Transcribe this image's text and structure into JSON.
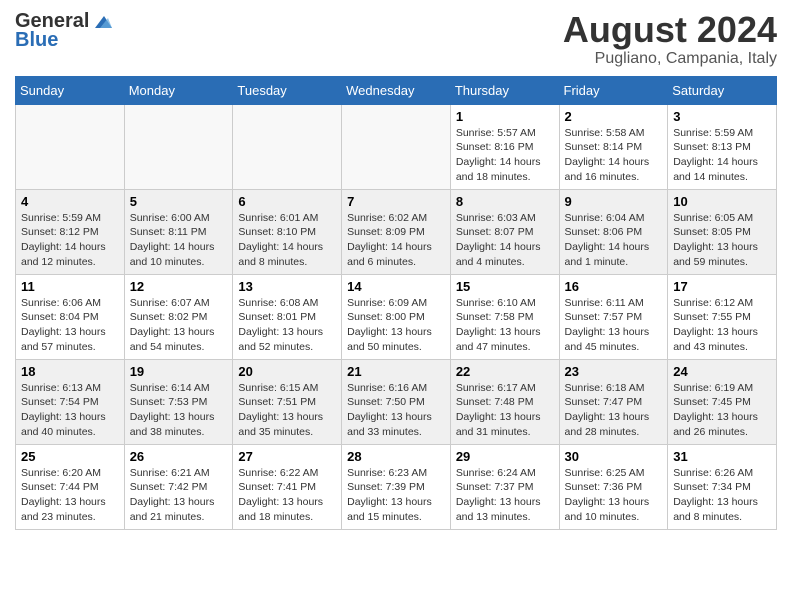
{
  "header": {
    "logo_general": "General",
    "logo_blue": "Blue",
    "title": "August 2024",
    "subtitle": "Pugliano, Campania, Italy"
  },
  "weekdays": [
    "Sunday",
    "Monday",
    "Tuesday",
    "Wednesday",
    "Thursday",
    "Friday",
    "Saturday"
  ],
  "weeks": [
    [
      {
        "day": "",
        "info": ""
      },
      {
        "day": "",
        "info": ""
      },
      {
        "day": "",
        "info": ""
      },
      {
        "day": "",
        "info": ""
      },
      {
        "day": "1",
        "info": "Sunrise: 5:57 AM\nSunset: 8:16 PM\nDaylight: 14 hours\nand 18 minutes."
      },
      {
        "day": "2",
        "info": "Sunrise: 5:58 AM\nSunset: 8:14 PM\nDaylight: 14 hours\nand 16 minutes."
      },
      {
        "day": "3",
        "info": "Sunrise: 5:59 AM\nSunset: 8:13 PM\nDaylight: 14 hours\nand 14 minutes."
      }
    ],
    [
      {
        "day": "4",
        "info": "Sunrise: 5:59 AM\nSunset: 8:12 PM\nDaylight: 14 hours\nand 12 minutes."
      },
      {
        "day": "5",
        "info": "Sunrise: 6:00 AM\nSunset: 8:11 PM\nDaylight: 14 hours\nand 10 minutes."
      },
      {
        "day": "6",
        "info": "Sunrise: 6:01 AM\nSunset: 8:10 PM\nDaylight: 14 hours\nand 8 minutes."
      },
      {
        "day": "7",
        "info": "Sunrise: 6:02 AM\nSunset: 8:09 PM\nDaylight: 14 hours\nand 6 minutes."
      },
      {
        "day": "8",
        "info": "Sunrise: 6:03 AM\nSunset: 8:07 PM\nDaylight: 14 hours\nand 4 minutes."
      },
      {
        "day": "9",
        "info": "Sunrise: 6:04 AM\nSunset: 8:06 PM\nDaylight: 14 hours\nand 1 minute."
      },
      {
        "day": "10",
        "info": "Sunrise: 6:05 AM\nSunset: 8:05 PM\nDaylight: 13 hours\nand 59 minutes."
      }
    ],
    [
      {
        "day": "11",
        "info": "Sunrise: 6:06 AM\nSunset: 8:04 PM\nDaylight: 13 hours\nand 57 minutes."
      },
      {
        "day": "12",
        "info": "Sunrise: 6:07 AM\nSunset: 8:02 PM\nDaylight: 13 hours\nand 54 minutes."
      },
      {
        "day": "13",
        "info": "Sunrise: 6:08 AM\nSunset: 8:01 PM\nDaylight: 13 hours\nand 52 minutes."
      },
      {
        "day": "14",
        "info": "Sunrise: 6:09 AM\nSunset: 8:00 PM\nDaylight: 13 hours\nand 50 minutes."
      },
      {
        "day": "15",
        "info": "Sunrise: 6:10 AM\nSunset: 7:58 PM\nDaylight: 13 hours\nand 47 minutes."
      },
      {
        "day": "16",
        "info": "Sunrise: 6:11 AM\nSunset: 7:57 PM\nDaylight: 13 hours\nand 45 minutes."
      },
      {
        "day": "17",
        "info": "Sunrise: 6:12 AM\nSunset: 7:55 PM\nDaylight: 13 hours\nand 43 minutes."
      }
    ],
    [
      {
        "day": "18",
        "info": "Sunrise: 6:13 AM\nSunset: 7:54 PM\nDaylight: 13 hours\nand 40 minutes."
      },
      {
        "day": "19",
        "info": "Sunrise: 6:14 AM\nSunset: 7:53 PM\nDaylight: 13 hours\nand 38 minutes."
      },
      {
        "day": "20",
        "info": "Sunrise: 6:15 AM\nSunset: 7:51 PM\nDaylight: 13 hours\nand 35 minutes."
      },
      {
        "day": "21",
        "info": "Sunrise: 6:16 AM\nSunset: 7:50 PM\nDaylight: 13 hours\nand 33 minutes."
      },
      {
        "day": "22",
        "info": "Sunrise: 6:17 AM\nSunset: 7:48 PM\nDaylight: 13 hours\nand 31 minutes."
      },
      {
        "day": "23",
        "info": "Sunrise: 6:18 AM\nSunset: 7:47 PM\nDaylight: 13 hours\nand 28 minutes."
      },
      {
        "day": "24",
        "info": "Sunrise: 6:19 AM\nSunset: 7:45 PM\nDaylight: 13 hours\nand 26 minutes."
      }
    ],
    [
      {
        "day": "25",
        "info": "Sunrise: 6:20 AM\nSunset: 7:44 PM\nDaylight: 13 hours\nand 23 minutes."
      },
      {
        "day": "26",
        "info": "Sunrise: 6:21 AM\nSunset: 7:42 PM\nDaylight: 13 hours\nand 21 minutes."
      },
      {
        "day": "27",
        "info": "Sunrise: 6:22 AM\nSunset: 7:41 PM\nDaylight: 13 hours\nand 18 minutes."
      },
      {
        "day": "28",
        "info": "Sunrise: 6:23 AM\nSunset: 7:39 PM\nDaylight: 13 hours\nand 15 minutes."
      },
      {
        "day": "29",
        "info": "Sunrise: 6:24 AM\nSunset: 7:37 PM\nDaylight: 13 hours\nand 13 minutes."
      },
      {
        "day": "30",
        "info": "Sunrise: 6:25 AM\nSunset: 7:36 PM\nDaylight: 13 hours\nand 10 minutes."
      },
      {
        "day": "31",
        "info": "Sunrise: 6:26 AM\nSunset: 7:34 PM\nDaylight: 13 hours\nand 8 minutes."
      }
    ]
  ]
}
